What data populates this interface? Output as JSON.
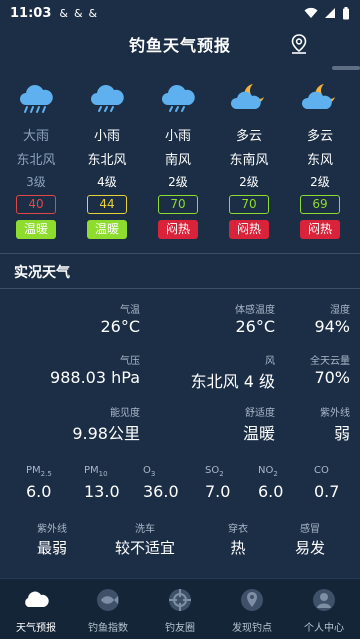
{
  "status_bar": {
    "time": "11:03",
    "notifications": [
      "&",
      "&",
      "&"
    ]
  },
  "header": {
    "title": "钓鱼天气预报"
  },
  "forecast": [
    {
      "condition": "大雨",
      "wind": "东北风",
      "level": "3级",
      "aqi": "40",
      "aqi_color": "#e04848",
      "comfort": "温暖",
      "comfort_color": "#8ddc2e",
      "icon": "heavy-rain-icon",
      "faded": true
    },
    {
      "condition": "小雨",
      "wind": "东北风",
      "level": "4级",
      "aqi": "44",
      "aqi_color": "#e8d23a",
      "comfort": "温暖",
      "comfort_color": "#8ddc2e",
      "icon": "light-rain-icon",
      "faded": false
    },
    {
      "condition": "小雨",
      "wind": "南风",
      "level": "2级",
      "aqi": "70",
      "aqi_color": "#8ddc2e",
      "comfort": "闷热",
      "comfort_color": "#d8233a",
      "icon": "light-rain-icon",
      "faded": false
    },
    {
      "condition": "多云",
      "wind": "东南风",
      "level": "2级",
      "aqi": "70",
      "aqi_color": "#8ddc2e",
      "comfort": "闷热",
      "comfort_color": "#d8233a",
      "icon": "cloudy-night-icon",
      "faded": false
    },
    {
      "condition": "多云",
      "wind": "东风",
      "level": "2级",
      "aqi": "69",
      "aqi_color": "#8ddc2e",
      "comfort": "闷热",
      "comfort_color": "#d8233a",
      "icon": "cloudy-night-icon",
      "faded": false
    }
  ],
  "current": {
    "section_title": "实况天气",
    "temp_label": "气温",
    "temp": "26°C",
    "feels_label": "体感温度",
    "feels": "26°C",
    "humidity_label": "湿度",
    "humidity": "94%",
    "pressure_label": "气压",
    "pressure": "988.03 hPa",
    "wind_label": "风",
    "wind": "东北风 4 级",
    "cloud_label": "全天云量",
    "cloud": "70%",
    "visibility_label": "能见度",
    "visibility": "9.98公里",
    "comfort_label": "舒适度",
    "comfort": "温暖",
    "uv_label": "紫外线",
    "uv": "弱"
  },
  "pollutants": [
    {
      "name": "PM",
      "sub": "2.5",
      "value": "6.0"
    },
    {
      "name": "PM",
      "sub": "10",
      "value": "13.0"
    },
    {
      "name": "O",
      "sub": "3",
      "value": "36.0"
    },
    {
      "name": "SO",
      "sub": "2",
      "value": "7.0"
    },
    {
      "name": "NO",
      "sub": "2",
      "value": "6.0"
    },
    {
      "name": "CO",
      "sub": "",
      "value": "0.7"
    }
  ],
  "indices": [
    {
      "label": "紫外线",
      "value": "最弱"
    },
    {
      "label": "洗车",
      "value": "较不适宜"
    },
    {
      "label": "穿衣",
      "value": "热"
    },
    {
      "label": "感冒",
      "value": "易发"
    }
  ],
  "nav": [
    {
      "label": "天气预报",
      "icon": "cloud-icon",
      "active": true
    },
    {
      "label": "钓鱼指数",
      "icon": "fish-icon",
      "active": false
    },
    {
      "label": "钓友圈",
      "icon": "aperture-icon",
      "active": false
    },
    {
      "label": "发现钓点",
      "icon": "map-pin-icon",
      "active": false
    },
    {
      "label": "个人中心",
      "icon": "user-icon",
      "active": false
    }
  ]
}
